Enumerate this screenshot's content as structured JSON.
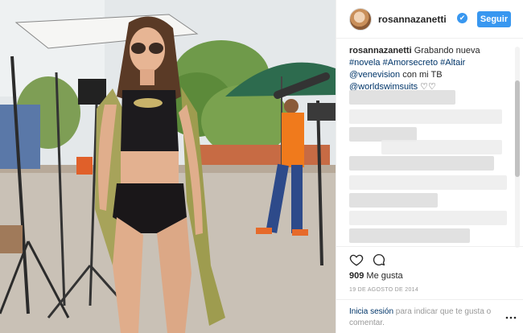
{
  "post": {
    "username": "rosannazanetti",
    "verified_icon": "verified-badge-icon",
    "verified_glyph": "✔",
    "follow_label": "Seguir",
    "caption": {
      "user": "rosannazanetti",
      "text_1": " Grabando nueva ",
      "tag_novela": "#novela",
      "tag_amorsecreto": "#Amorsecreto",
      "tag_altair": "#Altair",
      "mention_venevision": "@venevision",
      "text_2": " con mi TB ",
      "mention_worldswimsuits": "@worldswimsuits",
      "text_3": " ♡♡"
    },
    "likes_count": "909",
    "likes_label": " Me gusta",
    "date": "19 DE AGOSTO DE 2014",
    "login_link": "Inicia sesión",
    "login_text": " para indicar que te gusta o comentar."
  },
  "icons": {
    "like": "heart-icon",
    "comment": "comment-icon",
    "more": "more-options-icon"
  },
  "colors": {
    "accent": "#3897f0",
    "link": "#003569",
    "text": "#262626",
    "muted": "#999999"
  }
}
